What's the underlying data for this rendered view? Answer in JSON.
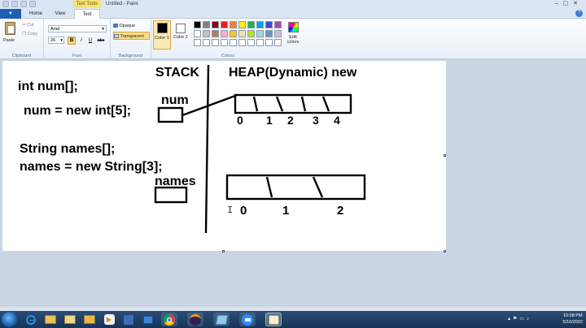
{
  "window": {
    "title": "Untitled - Paint",
    "context_tab": "Text Tools"
  },
  "tabs": {
    "file": "▼",
    "home": "Home",
    "view": "View",
    "text": "Text"
  },
  "ribbon": {
    "clipboard": {
      "label": "Clipboard",
      "paste": "Paste",
      "cut": "Cut",
      "copy": "Copy"
    },
    "font": {
      "label": "Font",
      "family": "Arial",
      "size": "26",
      "bold": "B",
      "italic": "I",
      "underline": "U",
      "strike": "abc"
    },
    "background": {
      "label": "Background",
      "opaque": "Opaque",
      "transparent": "Transparent"
    },
    "colors": {
      "label": "Colors",
      "color1": "Color 1",
      "color2": "Color 2",
      "edit": "Edit colors",
      "palette_row1": [
        "#000000",
        "#7f7f7f",
        "#880015",
        "#ed1c24",
        "#ff7f27",
        "#fff200",
        "#22b14c",
        "#00a2e8",
        "#3f48cc",
        "#a349a4"
      ],
      "palette_row2": [
        "#ffffff",
        "#c3c3c3",
        "#b97a57",
        "#ffaec9",
        "#ffc90e",
        "#efe4b0",
        "#b5e61d",
        "#99d9ea",
        "#7092be",
        "#c8bfe7"
      ],
      "palette_row3": [
        "#ffffff",
        "#ffffff",
        "#ffffff",
        "#ffffff",
        "#ffffff",
        "#ffffff",
        "#ffffff",
        "#ffffff",
        "#ffffff",
        "#ffffff"
      ]
    }
  },
  "drawing": {
    "stack_label": "STACK",
    "heap_label": "HEAP(Dynamic) new",
    "code_line1": "int num[];",
    "code_line2": "num = new int[5];",
    "code_line3": "String names[];",
    "code_line4": "names = new String[3];",
    "num_label": "num",
    "names_label": "names",
    "num_indices": [
      "0",
      "1",
      "2",
      "3",
      "4"
    ],
    "names_indices": [
      "0",
      "1",
      "2"
    ]
  },
  "taskbar": {
    "time": "10:08 PM",
    "date": "5/10/2022"
  }
}
